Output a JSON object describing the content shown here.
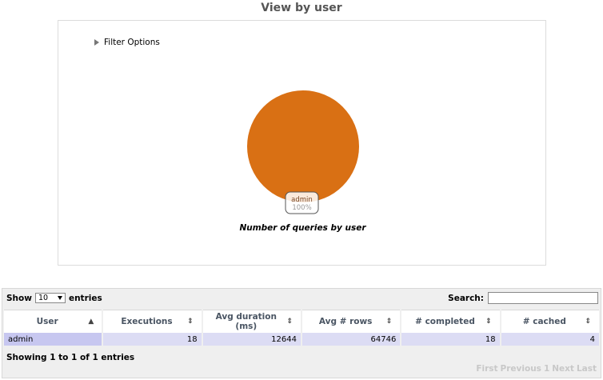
{
  "page": {
    "title": "View by user"
  },
  "filter": {
    "label": "Filter Options"
  },
  "chart_data": {
    "type": "pie",
    "title": "Number of queries by user",
    "slices": [
      {
        "label": "admin",
        "percent": "100%",
        "value": 100,
        "color": "#d97014"
      }
    ],
    "legend": "none"
  },
  "table": {
    "length": {
      "show_label": "Show",
      "selected": "10",
      "entries_label": "entries"
    },
    "search": {
      "label": "Search:",
      "value": ""
    },
    "columns": [
      {
        "label": "User",
        "sort": "▲"
      },
      {
        "label": "Executions",
        "sort": "⇕"
      },
      {
        "label": "Avg duration (ms)",
        "sort": "⇕"
      },
      {
        "label": "Avg # rows",
        "sort": "⇕"
      },
      {
        "label": "# completed",
        "sort": "⇕"
      },
      {
        "label": "# cached",
        "sort": "⇕"
      }
    ],
    "rows": [
      {
        "user": "admin",
        "executions": "18",
        "avg_duration": "12644",
        "avg_rows": "64746",
        "completed": "18",
        "cached": "4"
      }
    ],
    "info": "Showing 1 to 1 of 1 entries",
    "pagination": {
      "first": "First",
      "previous": "Previous",
      "page": "1",
      "next": "Next",
      "last": "Last"
    }
  }
}
